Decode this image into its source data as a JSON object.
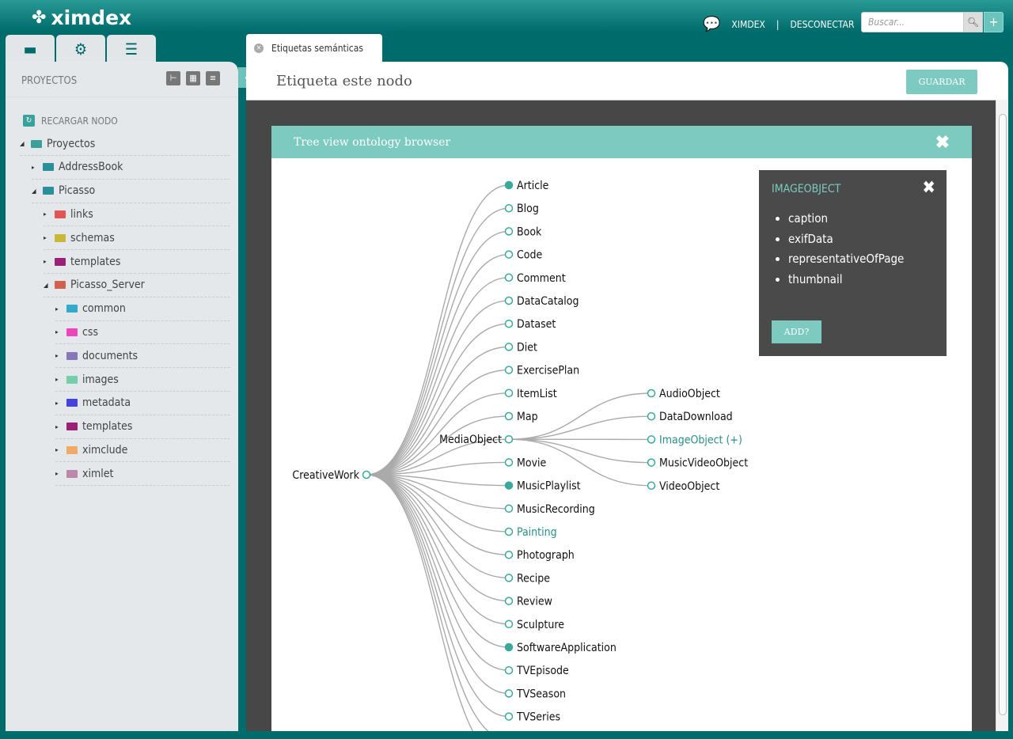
{
  "app": {
    "logo": "ximdex",
    "user": "XIMDEX",
    "separator": "|",
    "logout": "DESCONECTAR",
    "search_placeholder": "Buscar...",
    "add": "+"
  },
  "sidebar": {
    "tabs": [
      "folder-icon",
      "gear-icon",
      "database-icon"
    ],
    "header": "PROYECTOS",
    "reload": "RECARGAR NODO",
    "items": [
      {
        "label": "Proyectos",
        "level": 0,
        "expanded": true,
        "color": "#3aa09a",
        "icon": "projects-icon"
      },
      {
        "label": "AddressBook",
        "level": 1,
        "expanded": false,
        "color": "#2a8f9a",
        "icon": "project-icon"
      },
      {
        "label": "Picasso",
        "level": 1,
        "expanded": true,
        "color": "#2a8f9a",
        "icon": "project-icon"
      },
      {
        "label": "links",
        "level": 2,
        "expanded": false,
        "color": "#e05555",
        "icon": "folder-icon"
      },
      {
        "label": "schemas",
        "level": 2,
        "expanded": false,
        "color": "#c9b838",
        "icon": "folder-icon"
      },
      {
        "label": "templates",
        "level": 2,
        "expanded": false,
        "color": "#992277",
        "icon": "folder-icon"
      },
      {
        "label": "Picasso_Server",
        "level": 2,
        "expanded": true,
        "color": "#d06050",
        "icon": "server-icon"
      },
      {
        "label": "common",
        "level": 3,
        "expanded": false,
        "color": "#33aacc",
        "icon": "folder-icon"
      },
      {
        "label": "css",
        "level": 3,
        "expanded": false,
        "color": "#ee44bb",
        "icon": "folder-icon"
      },
      {
        "label": "documents",
        "level": 3,
        "expanded": false,
        "color": "#8877bb",
        "icon": "folder-icon"
      },
      {
        "label": "images",
        "level": 3,
        "expanded": false,
        "color": "#77ccaa",
        "icon": "folder-icon"
      },
      {
        "label": "metadata",
        "level": 3,
        "expanded": false,
        "color": "#4444dd",
        "icon": "folder-icon"
      },
      {
        "label": "templates",
        "level": 3,
        "expanded": false,
        "color": "#992277",
        "icon": "folder-icon"
      },
      {
        "label": "ximclude",
        "level": 3,
        "expanded": false,
        "color": "#eeaa66",
        "icon": "folder-icon"
      },
      {
        "label": "ximlet",
        "level": 3,
        "expanded": false,
        "color": "#bb88aa",
        "icon": "folder-icon"
      }
    ]
  },
  "main": {
    "tab": "Etiquetas semánticas",
    "title": "Etiqueta este nodo",
    "save": "GUARDAR"
  },
  "ontology": {
    "title": "Tree view ontology browser",
    "root": "CreativeWork",
    "children": [
      {
        "label": "Article",
        "filled": true
      },
      {
        "label": "Blog"
      },
      {
        "label": "Book"
      },
      {
        "label": "Code"
      },
      {
        "label": "Comment"
      },
      {
        "label": "DataCatalog"
      },
      {
        "label": "Dataset"
      },
      {
        "label": "Diet"
      },
      {
        "label": "ExercisePlan"
      },
      {
        "label": "ItemList"
      },
      {
        "label": "Map"
      },
      {
        "label": "MediaObject",
        "expanded": true,
        "children": [
          {
            "label": "AudioObject"
          },
          {
            "label": "DataDownload"
          },
          {
            "label": "ImageObject (+)",
            "highlight": true
          },
          {
            "label": "MusicVideoObject"
          },
          {
            "label": "VideoObject"
          }
        ]
      },
      {
        "label": "Movie"
      },
      {
        "label": "MusicPlaylist",
        "filled": true
      },
      {
        "label": "MusicRecording"
      },
      {
        "label": "Painting",
        "highlight": true
      },
      {
        "label": "Photograph"
      },
      {
        "label": "Recipe"
      },
      {
        "label": "Review"
      },
      {
        "label": "Sculpture"
      },
      {
        "label": "SoftwareApplication",
        "filled": true
      },
      {
        "label": "TVEpisode"
      },
      {
        "label": "TVSeason"
      },
      {
        "label": "TVSeries"
      }
    ],
    "info": {
      "title": "IMAGEOBJECT",
      "properties": [
        "caption",
        "exifData",
        "representativeOfPage",
        "thumbnail"
      ],
      "add": "ADD?"
    }
  },
  "colors": {
    "accent": "#7ccac0",
    "brand": "#006b6b",
    "node": "#3aa89c"
  }
}
